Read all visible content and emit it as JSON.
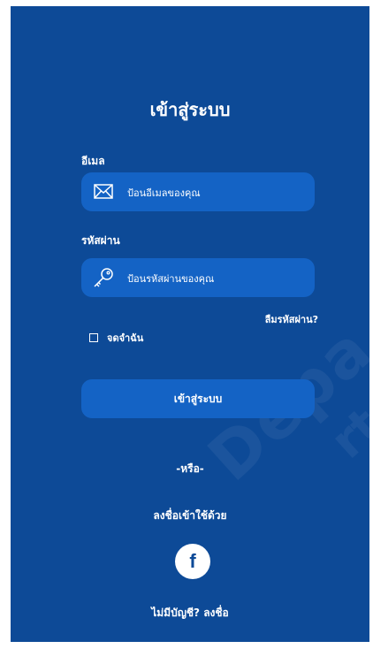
{
  "colors": {
    "background": "#0d4a97",
    "field": "#1463c5",
    "text": "#ffffff"
  },
  "login": {
    "title": "เข้าสู่ระบบ",
    "email_label": "อีเมล",
    "email_placeholder": "ป้อนอีเมลของคุณ",
    "password_label": "รหัสผ่าน",
    "password_placeholder": "ป้อนรหัสผ่านของคุณ",
    "forgot_password": "ลืมรหัสผ่าน?",
    "remember_me": "จดจำฉัน",
    "submit_label": "เข้าสู่ระบบ",
    "or_divider": "-หรือ-",
    "social_label": "ลงชื่อเข้าใช้ด้วย",
    "social_icon": "facebook-icon",
    "facebook_glyph": "f",
    "signup_text": "ไม่มีบัญชี? ลงชื่อ"
  }
}
